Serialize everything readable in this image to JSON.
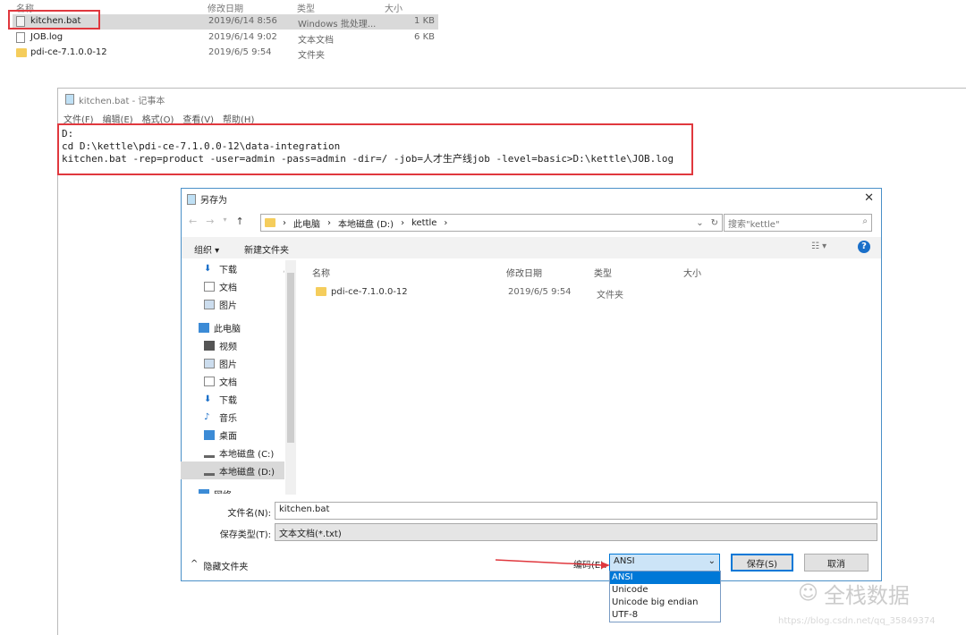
{
  "explorer": {
    "columns": [
      "名称",
      "修改日期",
      "类型",
      "大小"
    ],
    "rows": [
      {
        "name": "kitchen.bat",
        "date": "2019/6/14 8:56",
        "type": "Windows 批处理...",
        "size": "1 KB",
        "icon": "bat-file-icon"
      },
      {
        "name": "JOB.log",
        "date": "2019/6/14 9:02",
        "type": "文本文档",
        "size": "6 KB",
        "icon": "text-file-icon"
      },
      {
        "name": "pdi-ce-7.1.0.0-12",
        "date": "2019/6/5 9:54",
        "type": "文件夹",
        "size": "",
        "icon": "folder-icon"
      }
    ]
  },
  "notepad": {
    "title": "kitchen.bat - 记事本",
    "menu": [
      "文件(F)",
      "编辑(E)",
      "格式(O)",
      "查看(V)",
      "帮助(H)"
    ],
    "lines": [
      "D:",
      "cd D:\\kettle\\pdi-ce-7.1.0.0-12\\data-integration",
      "kitchen.bat -rep=product -user=admin -pass=admin -dir=/ -job=人才生产线job -level=basic>D:\\kettle\\JOB.log"
    ]
  },
  "dialog": {
    "title": "另存为",
    "close": "✕",
    "breadcrumb": [
      "此电脑",
      "本地磁盘 (D:)",
      "kettle"
    ],
    "search_placeholder": "搜索\"kettle\"",
    "toolbar": {
      "organize": "组织 ▾",
      "new_folder": "新建文件夹",
      "help": "?"
    },
    "columns": [
      "名称",
      "修改日期",
      "类型",
      "大小"
    ],
    "files": [
      {
        "name": "pdi-ce-7.1.0.0-12",
        "date": "2019/6/5 9:54",
        "type": "文件夹",
        "size": ""
      }
    ],
    "sidebar": [
      "下载",
      "文档",
      "图片",
      "此电脑",
      "视频",
      "图片",
      "文档",
      "下载",
      "音乐",
      "桌面",
      "本地磁盘 (C:)",
      "本地磁盘 (D:)",
      "网络"
    ],
    "filename_label": "文件名(N):",
    "filename": "kitchen.bat",
    "savetype_label": "保存类型(T):",
    "savetype": "文本文档(*.txt)",
    "hide_folders": "隐藏文件夹",
    "encoding_label": "编码(E):",
    "encoding": "ANSI",
    "encoding_options": [
      "ANSI",
      "Unicode",
      "Unicode big endian",
      "UTF-8"
    ],
    "save": "保存(S)",
    "cancel": "取消"
  },
  "watermark": {
    "brand": "全栈数据",
    "url": "https://blog.csdn.net/qq_35849374"
  },
  "colors": {
    "highlight": "#e0383e",
    "selection": "#0078d7",
    "accent": "#4a90c8"
  }
}
